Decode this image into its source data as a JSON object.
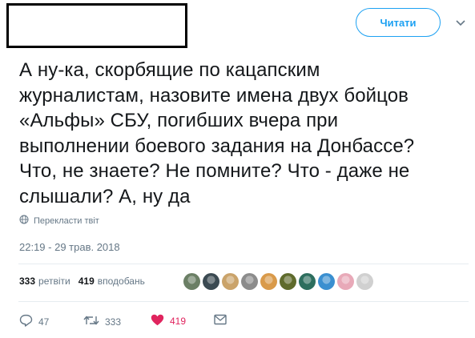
{
  "header": {
    "follow_label": "Читати"
  },
  "tweet": {
    "text": "А ну-ка, скорбящие по кацапским\nжурналистам, назовите имена двух бойцов\n«Альфы» СБУ, погибших вчера при\nвыполнении боевого задания на Донбассе?\nЧто, не знаете? Не помните? Что - даже не\nслышали? А, ну да",
    "translate_label": "Перекласти твіт",
    "timestamp": "22:19 - 29 трав. 2018"
  },
  "stats": {
    "retweets_count": "333",
    "retweets_label": "ретвіти",
    "likes_count": "419",
    "likes_label": "вподобань",
    "avatar_colors": [
      "#6b7f65",
      "#3b4a52",
      "#caa36a",
      "#8c8c8c",
      "#d99a4a",
      "#5f6b2c",
      "#2d6e5e",
      "#3a8fd0",
      "#e8a9b8",
      "#d0d0d0"
    ]
  },
  "actions": {
    "reply_count": "47",
    "retweet_count": "333",
    "like_count": "419",
    "accent": "#e0245e"
  }
}
